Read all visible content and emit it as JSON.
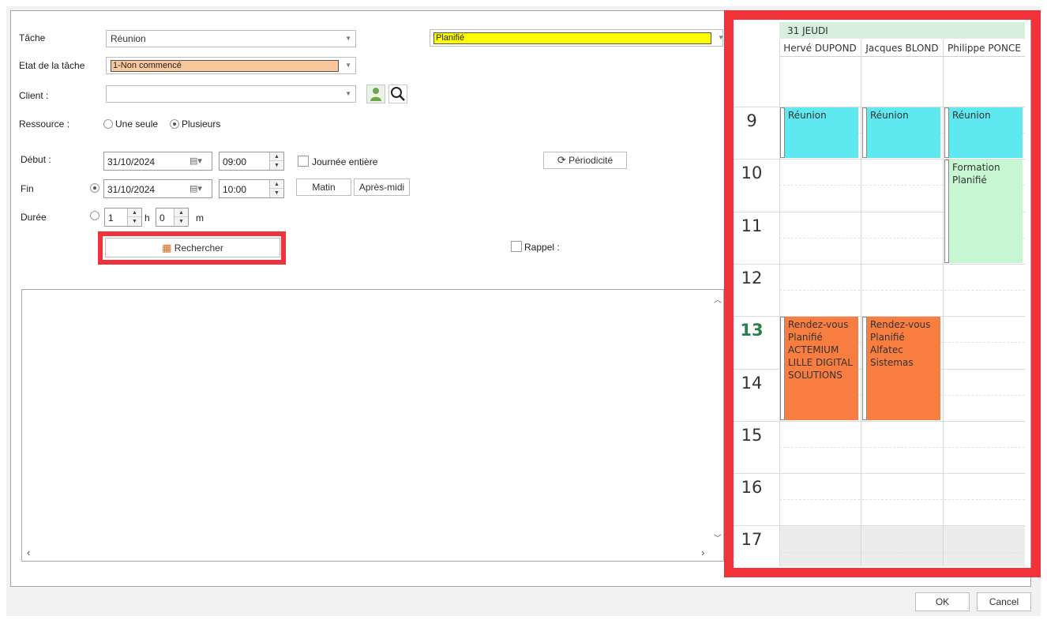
{
  "form": {
    "tache_label": "Tâche",
    "tache_value": "Réunion",
    "status_value": "Planifié",
    "etat_label": "Etat de la tâche",
    "etat_value": "1-Non commencé",
    "client_label": "Client :",
    "client_value": "",
    "ressource_label": "Ressource :",
    "ressource_options": [
      "Une seule",
      "Plusieurs"
    ],
    "ressource_selected": "Plusieurs",
    "debut_label": "Début :",
    "debut_date": "31/10/2024",
    "debut_time": "09:00",
    "journee_label": "Journée entière",
    "periodicite_label": "Périodicité",
    "fin_label": "Fin",
    "fin_date": "31/10/2024",
    "fin_time": "10:00",
    "matin_label": "Matin",
    "apresmidi_label": "Après-midi",
    "duree_label": "Durée",
    "duree_hours": "1",
    "duree_h_unit": "h",
    "duree_minutes": "0",
    "duree_m_unit": "m",
    "rechercher_label": "Rechercher",
    "rappel_label": "Rappel :"
  },
  "footer": {
    "ok_label": "OK",
    "cancel_label": "Cancel"
  },
  "calendar": {
    "day_header": "31 JEUDI",
    "resources": [
      "Hervé DUPOND",
      "Jacques BLOND",
      "Philippe PONCE"
    ],
    "hours": [
      "9",
      "10",
      "11",
      "12",
      "13",
      "14",
      "15",
      "16",
      "17"
    ],
    "current_hour": "13",
    "appointments": [
      {
        "resource": 0,
        "start": 9,
        "end": 10,
        "lines": [
          "Réunion"
        ],
        "color": "#5ee8f0"
      },
      {
        "resource": 1,
        "start": 9,
        "end": 10,
        "lines": [
          "Réunion"
        ],
        "color": "#5ee8f0"
      },
      {
        "resource": 2,
        "start": 9,
        "end": 10,
        "lines": [
          "Réunion"
        ],
        "color": "#5ee8f0"
      },
      {
        "resource": 2,
        "start": 10,
        "end": 12,
        "lines": [
          "Formation",
          "Planifié"
        ],
        "color": "#c6f6d2"
      },
      {
        "resource": 0,
        "start": 13,
        "end": 15,
        "lines": [
          "Rendez-vous",
          "Planifié",
          "ACTEMIUM",
          "LILLE DIGITAL",
          "SOLUTIONS"
        ],
        "color": "#f77e40"
      },
      {
        "resource": 1,
        "start": 13,
        "end": 15,
        "lines": [
          "Rendez-vous",
          "Planifié",
          "Alfatec",
          "Sistemas"
        ],
        "color": "#f77e40"
      }
    ]
  },
  "colors": {
    "highlight_red": "#f0323a",
    "header_green": "#d7efdc",
    "status_yellow": "#ffff00",
    "etat_peach": "#f9c79c"
  }
}
